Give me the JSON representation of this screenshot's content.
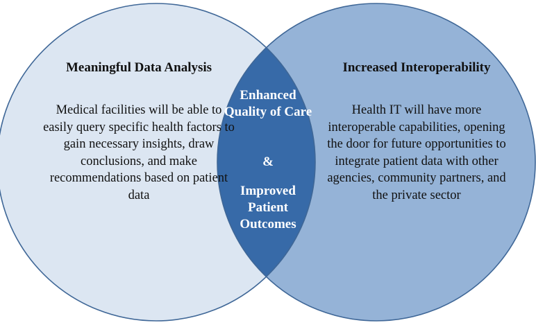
{
  "left": {
    "title": "Meaningful Data Analysis",
    "body": "Medical facilities will be able to easily query specific health factors to gain necessary insights, draw conclusions, and make recommendations based on patient data"
  },
  "right": {
    "title": "Increased Interoperability",
    "body": "Health IT will have more interoperable capabilities, opening the door for future opportunities to integrate patient data with other agencies, community partners, and the private sector"
  },
  "center": {
    "top": "Enhanced Quality of Care",
    "amp": "&",
    "bottom": "Improved Patient Outcomes"
  },
  "colors": {
    "left_fill": "#dce6f2",
    "right_fill": "#95b3d7",
    "overlap_fill": "#376aa8",
    "stroke": "#3f6797"
  }
}
